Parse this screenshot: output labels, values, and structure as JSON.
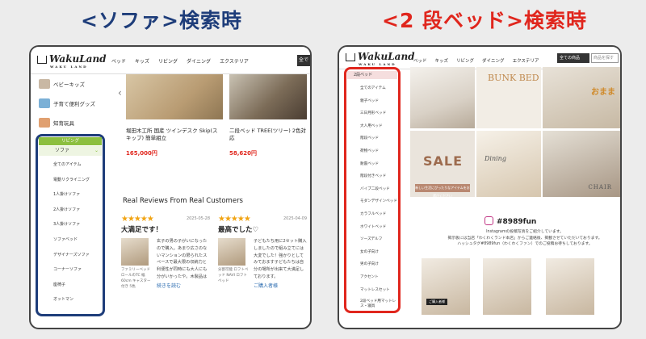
{
  "captions": {
    "left": "<ソファ>検索時",
    "right": "<2 段ベッド>検索時"
  },
  "header": {
    "logo_main": "WakuLand",
    "logo_sub": "WAKU LAND",
    "nav": [
      "ベッド",
      "キッズ",
      "リビング",
      "ダイニング",
      "エクステリア"
    ],
    "button_label": "全で",
    "select_label": "全ての商品",
    "search_placeholder": "商品を探す"
  },
  "left_panel": {
    "categories": [
      {
        "label": "ベビーキッズ"
      },
      {
        "label": "子育て便利グッズ"
      },
      {
        "label": "知育玩具"
      }
    ],
    "section_header": "リビング",
    "active_item": "ソファ",
    "sub_items": [
      "全てのアイテム",
      "電動リクライニング",
      "1人掛けソファ",
      "2人掛けソファ",
      "3人掛けソファ",
      "ソファベッド",
      "デザイナーズソファ",
      "コーナーソファ",
      "座椅子",
      "オットマン"
    ],
    "products": [
      {
        "name": "堀田木工所 国産 ツインデスク Skip(スキップ) 簡単組立",
        "price": "165,000円"
      },
      {
        "name": "二段ベッド TREE(ツリー) 2色対応",
        "price": "58,620円"
      }
    ],
    "reviews_title": "Real Reviews From Real Customers",
    "reviews": [
      {
        "stars": "★★★★★",
        "date": "2025-05-28",
        "title": "大満足です！",
        "text": "玄子の男の子がいになったので購入。あまり広さのないマンションの限られたスペースで最大限の収納力と利便性が同時にも大人にも分がいかったや。木製品はサイズ感や使い勝手、質感、棚の区分、全てが本当に最高でした！組み立ててだけが組掛量として、日頃に別で1つに仕",
        "meta": "ファミリーベッドロールのTC 幅60cm キャスター付き 5色",
        "more": "続きを読む"
      },
      {
        "stars": "★★★★★",
        "date": "2025-04-09",
        "title": "最高でした♡",
        "text": "子どもたち用に2セット購入しましたので組み立てには大変でした！強かりとしてみておます子どもたちは自分の場所が出来て大満足しております。",
        "meta": "分割可能 ロフトベッド NAVI ロフト ベッド",
        "more": "ご購入者様"
      }
    ]
  },
  "right_panel": {
    "search_header": "2段ベッド",
    "sub_items": [
      "全てのアイテム",
      "親子ベッド",
      "三日月形ベッド",
      "大人用ベッド",
      "階段ベッド",
      "荷物ベッド",
      "耐震ベッド",
      "階段付きベッド",
      "バイブ二段ベッド",
      "モダンデザインベッド",
      "カラフルベッド",
      "ホワイトベッド",
      "ソーズデルフ",
      "女の子向け",
      "男の子向け",
      "アクセント",
      "マットレスセット",
      "2段ベッド用マットレス・寝具"
    ],
    "gallery_text": {
      "bunk": "BUNK BED",
      "omase": "おまま",
      "sale": "SALE",
      "sale_sub": "新しい生活にぴったりなアイテムをお選びください",
      "dining": "Dining",
      "chair": "CHAIR"
    },
    "instagram_tag": "#8989fun",
    "instagram_text": "Instagramの投稿写真をご紹介しています。\n掲示板には当店「わくわくランド本店」からご連絡後、掲載させていただいております。\nハッシュタグ#8989fun（わくわくファン）でのご投稿お待ちしております。",
    "badge": "ご購入者様"
  }
}
